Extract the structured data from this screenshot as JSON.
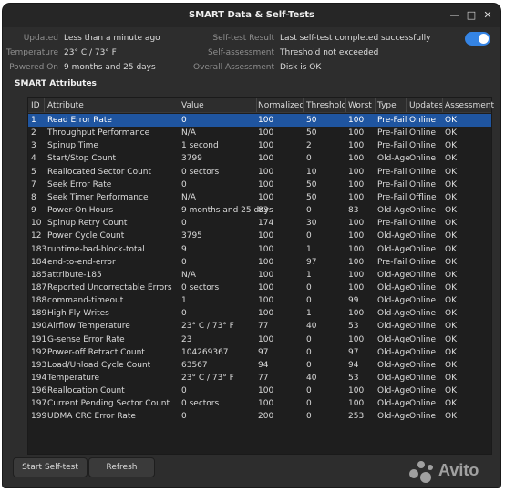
{
  "window": {
    "title": "SMART Data & Self-Tests"
  },
  "info": {
    "updated_label": "Updated",
    "updated_value": "Less than a minute ago",
    "temperature_label": "Temperature",
    "temperature_value": "23° C / 73° F",
    "powered_on_label": "Powered On",
    "powered_on_value": "9 months and 25 days",
    "selftest_result_label": "Self-test Result",
    "selftest_result_value": "Last self-test completed successfully",
    "self_assessment_label": "Self-assessment",
    "self_assessment_value": "Threshold not exceeded",
    "overall_assessment_label": "Overall Assessment",
    "overall_assessment_value": "Disk is OK",
    "smart_toggle": "on"
  },
  "section": {
    "title": "SMART Attributes"
  },
  "table": {
    "headers": [
      "ID",
      "Attribute",
      "Value",
      "Normalized",
      "Threshold",
      "Worst",
      "Type",
      "Updates",
      "Assessment"
    ],
    "rows": [
      [
        "1",
        "Read Error Rate",
        "0",
        "100",
        "50",
        "100",
        "Pre-Fail",
        "Online",
        "OK"
      ],
      [
        "2",
        "Throughput Performance",
        "N/A",
        "100",
        "50",
        "100",
        "Pre-Fail",
        "Online",
        "OK"
      ],
      [
        "3",
        "Spinup Time",
        "1 second",
        "100",
        "2",
        "100",
        "Pre-Fail",
        "Online",
        "OK"
      ],
      [
        "4",
        "Start/Stop Count",
        "3799",
        "100",
        "0",
        "100",
        "Old-Age",
        "Online",
        "OK"
      ],
      [
        "5",
        "Reallocated Sector Count",
        "0 sectors",
        "100",
        "10",
        "100",
        "Pre-Fail",
        "Online",
        "OK"
      ],
      [
        "7",
        "Seek Error Rate",
        "0",
        "100",
        "50",
        "100",
        "Pre-Fail",
        "Online",
        "OK"
      ],
      [
        "8",
        "Seek Timer Performance",
        "N/A",
        "100",
        "50",
        "100",
        "Pre-Fail",
        "Offline",
        "OK"
      ],
      [
        "9",
        "Power-On Hours",
        "9 months and 25 days",
        "83",
        "0",
        "83",
        "Old-Age",
        "Online",
        "OK"
      ],
      [
        "10",
        "Spinup Retry Count",
        "0",
        "174",
        "30",
        "100",
        "Pre-Fail",
        "Online",
        "OK"
      ],
      [
        "12",
        "Power Cycle Count",
        "3795",
        "100",
        "0",
        "100",
        "Old-Age",
        "Online",
        "OK"
      ],
      [
        "183",
        "runtime-bad-block-total",
        "9",
        "100",
        "1",
        "100",
        "Old-Age",
        "Online",
        "OK"
      ],
      [
        "184",
        "end-to-end-error",
        "0",
        "100",
        "97",
        "100",
        "Pre-Fail",
        "Online",
        "OK"
      ],
      [
        "185",
        "attribute-185",
        "N/A",
        "100",
        "1",
        "100",
        "Old-Age",
        "Online",
        "OK"
      ],
      [
        "187",
        "Reported Uncorrectable Errors",
        "0 sectors",
        "100",
        "0",
        "100",
        "Old-Age",
        "Online",
        "OK"
      ],
      [
        "188",
        "command-timeout",
        "1",
        "100",
        "0",
        "99",
        "Old-Age",
        "Online",
        "OK"
      ],
      [
        "189",
        "High Fly Writes",
        "0",
        "100",
        "1",
        "100",
        "Old-Age",
        "Online",
        "OK"
      ],
      [
        "190",
        "Airflow Temperature",
        "23° C / 73° F",
        "77",
        "40",
        "53",
        "Old-Age",
        "Online",
        "OK"
      ],
      [
        "191",
        "G-sense Error Rate",
        "23",
        "100",
        "0",
        "100",
        "Old-Age",
        "Online",
        "OK"
      ],
      [
        "192",
        "Power-off Retract Count",
        "104269367",
        "97",
        "0",
        "97",
        "Old-Age",
        "Online",
        "OK"
      ],
      [
        "193",
        "Load/Unload Cycle Count",
        "63567",
        "94",
        "0",
        "94",
        "Old-Age",
        "Online",
        "OK"
      ],
      [
        "194",
        "Temperature",
        "23° C / 73° F",
        "77",
        "40",
        "53",
        "Old-Age",
        "Online",
        "OK"
      ],
      [
        "196",
        "Reallocation Count",
        "0",
        "100",
        "0",
        "100",
        "Old-Age",
        "Online",
        "OK"
      ],
      [
        "197",
        "Current Pending Sector Count",
        "0 sectors",
        "100",
        "0",
        "100",
        "Old-Age",
        "Online",
        "OK"
      ],
      [
        "199",
        "UDMA CRC Error Rate",
        "0",
        "200",
        "0",
        "253",
        "Old-Age",
        "Online",
        "OK"
      ]
    ]
  },
  "buttons": {
    "start_selftest": "Start Self-test",
    "refresh": "Refresh"
  },
  "watermark": {
    "text": "Avito"
  },
  "colors": {
    "selection": "#1f55a0",
    "accent": "#3584e4"
  }
}
